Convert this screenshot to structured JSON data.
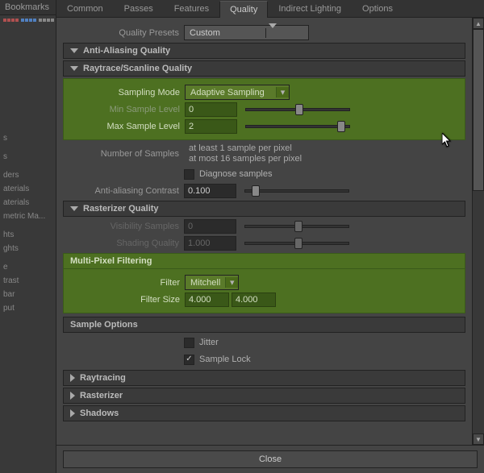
{
  "bookmarks_title": "Bookmarks",
  "bookmark_items": [
    "",
    "",
    "s",
    "",
    "s",
    "",
    "ders",
    "aterials",
    "aterials",
    "metric Ma...",
    "",
    "hts",
    "ghts",
    "",
    "e",
    "trast",
    "bar",
    "put"
  ],
  "tabs": {
    "common": "Common",
    "passes": "Passes",
    "features": "Features",
    "quality": "Quality",
    "indirect": "Indirect Lighting",
    "options": "Options"
  },
  "quality_presets": {
    "label": "Quality Presets",
    "value": "Custom"
  },
  "aa_quality": {
    "title": "Anti-Aliasing Quality"
  },
  "raytrace": {
    "title": "Raytrace/Scanline Quality",
    "sampling_mode": {
      "label": "Sampling Mode",
      "value": "Adaptive Sampling"
    },
    "min_sample": {
      "label": "Min Sample Level",
      "value": "0"
    },
    "max_sample": {
      "label": "Max Sample Level",
      "value": "2"
    },
    "num_samples": {
      "label": "Number of Samples",
      "line1": "at least 1 sample per pixel",
      "line2": "at most 16 samples per pixel"
    },
    "diagnose": {
      "label": "Diagnose samples",
      "checked": false
    },
    "aa_contrast": {
      "label": "Anti-aliasing Contrast",
      "value": "0.100"
    }
  },
  "rasterizer": {
    "title": "Rasterizer Quality",
    "vis_samples": {
      "label": "Visibility Samples",
      "value": "0"
    },
    "shading_q": {
      "label": "Shading Quality",
      "value": "1.000"
    }
  },
  "mpf": {
    "title": "Multi-Pixel Filtering",
    "filter": {
      "label": "Filter",
      "value": "Mitchell"
    },
    "filter_size": {
      "label": "Filter Size",
      "v1": "4.000",
      "v2": "4.000"
    }
  },
  "sample_opts": {
    "title": "Sample Options",
    "jitter": {
      "label": "Jitter",
      "checked": false
    },
    "sample_lock": {
      "label": "Sample Lock",
      "checked": true
    }
  },
  "collapsed": {
    "raytracing": "Raytracing",
    "rasterizer2": "Rasterizer",
    "shadows": "Shadows"
  },
  "close": "Close"
}
